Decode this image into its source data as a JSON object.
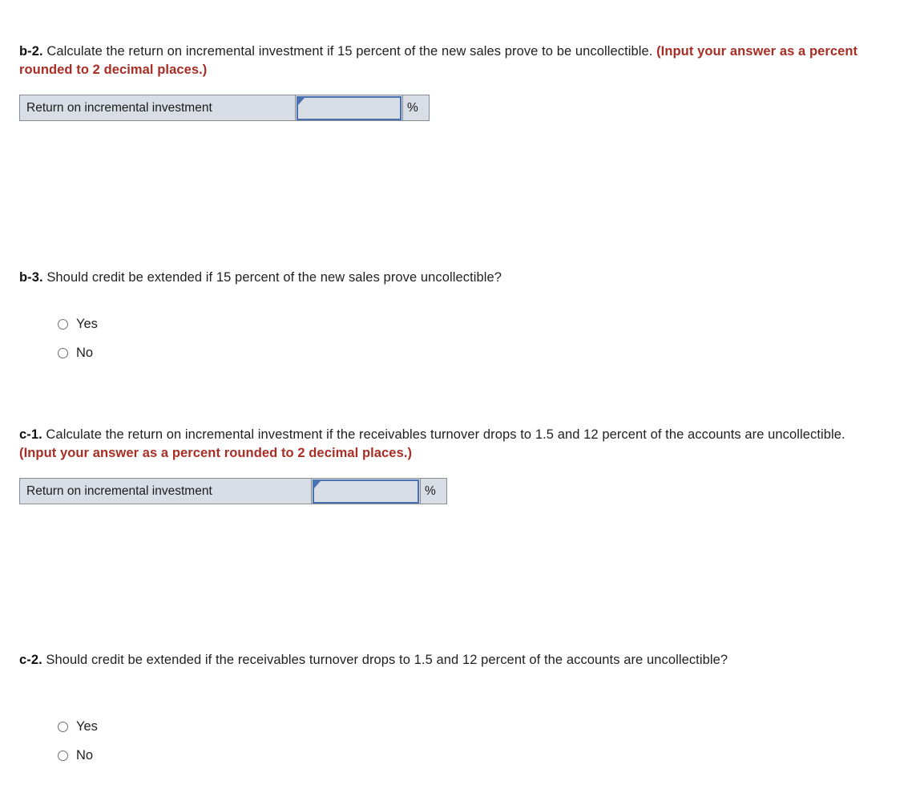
{
  "questions": {
    "b2": {
      "label": "b-2.",
      "text": " Calculate the return on incremental investment if 15 percent of the new sales prove to be uncollectible. ",
      "note": "(Input your answer as a percent rounded to 2 decimal places.)"
    },
    "b3": {
      "label": "b-3.",
      "text": " Should credit be extended if 15 percent of the new sales prove uncollectible?"
    },
    "c1": {
      "label": "c-1.",
      "text": " Calculate the return on incremental investment if the receivables turnover drops to 1.5 and 12 percent of the accounts are uncollectible. ",
      "note": "(Input your answer as a percent rounded to 2 decimal places.)"
    },
    "c2": {
      "label": "c-2.",
      "text": " Should credit be extended if the receivables turnover drops to 1.5 and 12 percent of the accounts are uncollectible?"
    }
  },
  "answer_tables": {
    "b2": {
      "row_label": "Return on incremental investment",
      "value": "",
      "placeholder": "",
      "unit": "%"
    },
    "c1": {
      "row_label": "Return on incremental investment",
      "value": "",
      "placeholder": "",
      "unit": "%"
    }
  },
  "radio_groups": {
    "b3": {
      "options": [
        {
          "label": "Yes",
          "selected": false
        },
        {
          "label": "No",
          "selected": false
        }
      ]
    },
    "c2": {
      "options": [
        {
          "label": "Yes",
          "selected": false
        },
        {
          "label": "No",
          "selected": false
        }
      ]
    }
  },
  "colors": {
    "note_red": "#a82d24",
    "cell_fill": "#d9dde6",
    "cell_border": "#888d94",
    "input_border": "#4a72b0",
    "text": "#1f1f1f",
    "page_background": "#ffffff"
  }
}
